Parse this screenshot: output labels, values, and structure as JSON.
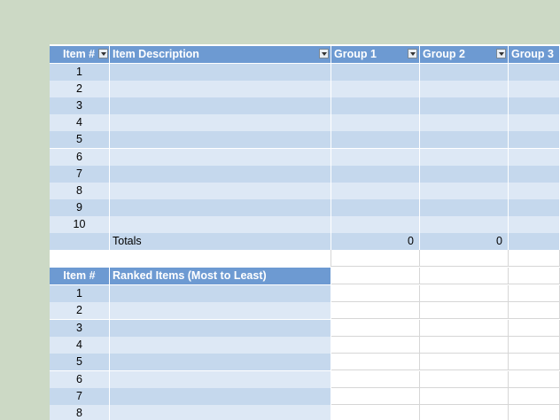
{
  "table1": {
    "headers": {
      "item": "Item #",
      "description": "Item Description",
      "group1": "Group 1",
      "group2": "Group 2",
      "group3": "Group 3"
    },
    "rows": [
      "1",
      "2",
      "3",
      "4",
      "5",
      "6",
      "7",
      "8",
      "9",
      "10"
    ],
    "totals_label": "Totals",
    "totals": {
      "group1": "0",
      "group2": "0"
    }
  },
  "table2": {
    "headers": {
      "item": "Item #",
      "ranked": "Ranked Items (Most to Least)"
    },
    "rows": [
      "1",
      "2",
      "3",
      "4",
      "5",
      "6",
      "7",
      "8"
    ]
  },
  "colors": {
    "header": "#6d9ad2",
    "band_dark": "#c5d8ed",
    "band_light": "#dde8f5",
    "background": "#ccd9c5"
  },
  "icons": {
    "filter": "filter-dropdown-icon"
  }
}
